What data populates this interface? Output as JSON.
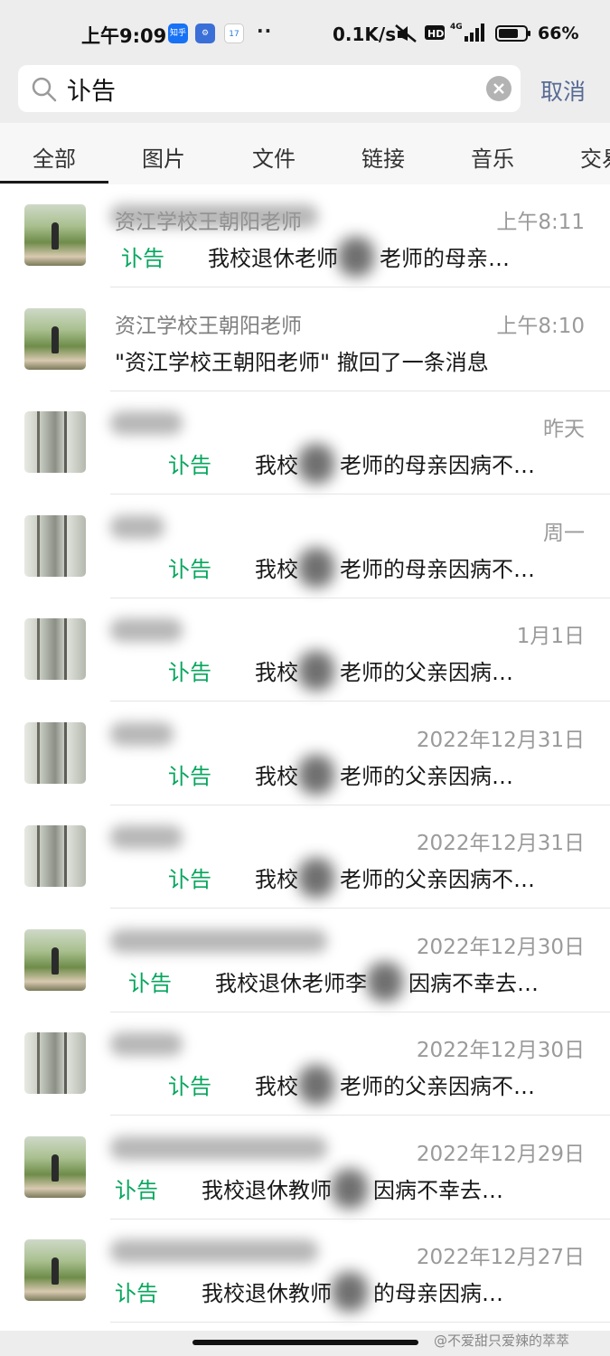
{
  "status_bar": {
    "time": "上午9:09",
    "apps": [
      "知乎",
      "⚙",
      "17"
    ],
    "more": "··",
    "net_speed": "0.1K/s",
    "battery": "66%"
  },
  "search": {
    "query": "讣告",
    "cancel_label": "取消"
  },
  "tabs": [
    "全部",
    "图片",
    "文件",
    "链接",
    "音乐",
    "交易"
  ],
  "results": [
    {
      "name": "资江学校王朝阳老师",
      "time": "上午8:11",
      "prefix": "讣告",
      "text": "我校退休老师",
      "text2": "老师的母亲…",
      "avatar": "garden",
      "name_blurred": true
    },
    {
      "name": "资江学校王朝阳老师",
      "time": "上午8:10",
      "prefix": "",
      "text": "\"资江学校王朝阳老师\" 撤回了一条消息",
      "text2": "",
      "avatar": "garden",
      "name_blurred": false
    },
    {
      "name": "",
      "time": "昨天",
      "prefix": "讣告",
      "text": "我校",
      "text2": "老师的母亲因病不…",
      "avatar": "tree",
      "name_blurred": true
    },
    {
      "name": "",
      "time": "周一",
      "prefix": "讣告",
      "text": "我校",
      "text2": "老师的母亲因病不…",
      "avatar": "tree",
      "name_blurred": true
    },
    {
      "name": "",
      "time": "1月1日",
      "prefix": "讣告",
      "text": "我校",
      "text2": "老师的父亲因病…",
      "avatar": "tree",
      "name_blurred": true
    },
    {
      "name": "",
      "time": "2022年12月31日",
      "prefix": "讣告",
      "text": "我校",
      "text2": "老师的父亲因病…",
      "avatar": "tree",
      "name_blurred": true
    },
    {
      "name": "",
      "time": "2022年12月31日",
      "prefix": "讣告",
      "text": "我校",
      "text2": "老师的父亲因病不…",
      "avatar": "tree",
      "name_blurred": true
    },
    {
      "name": "",
      "time": "2022年12月30日",
      "prefix": "讣告",
      "text": "我校退休老师李",
      "text2": "因病不幸去…",
      "avatar": "garden",
      "name_blurred": true
    },
    {
      "name": "",
      "time": "2022年12月30日",
      "prefix": "讣告",
      "text": "我校",
      "text2": "老师的父亲因病不…",
      "avatar": "tree",
      "name_blurred": true
    },
    {
      "name": "",
      "time": "2022年12月29日",
      "prefix": "讣告",
      "text": "我校退休教师",
      "text2": "因病不幸去…",
      "avatar": "garden",
      "name_blurred": true
    },
    {
      "name": "",
      "time": "2022年12月27日",
      "prefix": "讣告",
      "text": "我校退休教师",
      "text2": "的母亲因病…",
      "avatar": "garden",
      "name_blurred": true
    }
  ],
  "watermark": "@不爱甜只爱辣的萃萃"
}
